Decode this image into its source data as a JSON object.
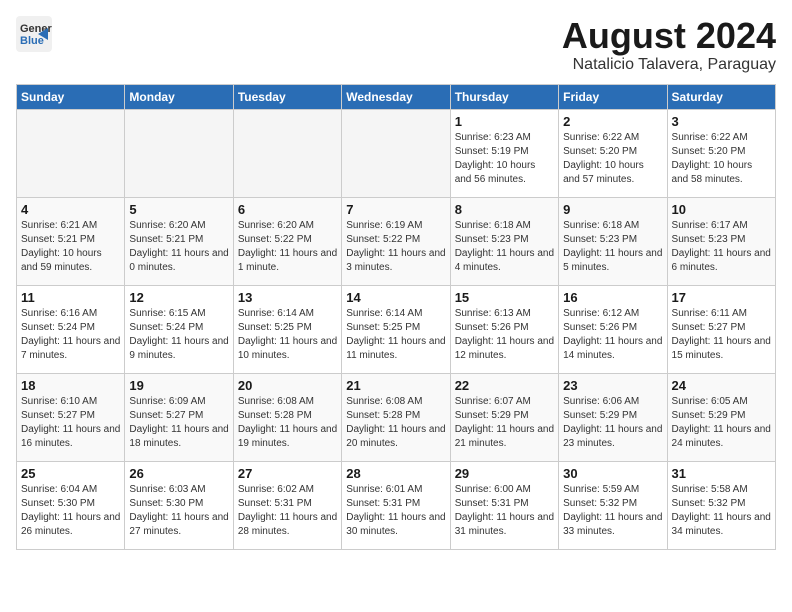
{
  "header": {
    "logo_general": "General",
    "logo_blue": "Blue",
    "month_year": "August 2024",
    "location": "Natalicio Talavera, Paraguay"
  },
  "days_of_week": [
    "Sunday",
    "Monday",
    "Tuesday",
    "Wednesday",
    "Thursday",
    "Friday",
    "Saturday"
  ],
  "weeks": [
    [
      {
        "day": "",
        "sunrise": "",
        "sunset": "",
        "daylight": "",
        "empty": true
      },
      {
        "day": "",
        "sunrise": "",
        "sunset": "",
        "daylight": "",
        "empty": true
      },
      {
        "day": "",
        "sunrise": "",
        "sunset": "",
        "daylight": "",
        "empty": true
      },
      {
        "day": "",
        "sunrise": "",
        "sunset": "",
        "daylight": "",
        "empty": true
      },
      {
        "day": "1",
        "sunrise": "Sunrise: 6:23 AM",
        "sunset": "Sunset: 5:19 PM",
        "daylight": "Daylight: 10 hours and 56 minutes."
      },
      {
        "day": "2",
        "sunrise": "Sunrise: 6:22 AM",
        "sunset": "Sunset: 5:20 PM",
        "daylight": "Daylight: 10 hours and 57 minutes."
      },
      {
        "day": "3",
        "sunrise": "Sunrise: 6:22 AM",
        "sunset": "Sunset: 5:20 PM",
        "daylight": "Daylight: 10 hours and 58 minutes."
      }
    ],
    [
      {
        "day": "4",
        "sunrise": "Sunrise: 6:21 AM",
        "sunset": "Sunset: 5:21 PM",
        "daylight": "Daylight: 10 hours and 59 minutes."
      },
      {
        "day": "5",
        "sunrise": "Sunrise: 6:20 AM",
        "sunset": "Sunset: 5:21 PM",
        "daylight": "Daylight: 11 hours and 0 minutes."
      },
      {
        "day": "6",
        "sunrise": "Sunrise: 6:20 AM",
        "sunset": "Sunset: 5:22 PM",
        "daylight": "Daylight: 11 hours and 1 minute."
      },
      {
        "day": "7",
        "sunrise": "Sunrise: 6:19 AM",
        "sunset": "Sunset: 5:22 PM",
        "daylight": "Daylight: 11 hours and 3 minutes."
      },
      {
        "day": "8",
        "sunrise": "Sunrise: 6:18 AM",
        "sunset": "Sunset: 5:23 PM",
        "daylight": "Daylight: 11 hours and 4 minutes."
      },
      {
        "day": "9",
        "sunrise": "Sunrise: 6:18 AM",
        "sunset": "Sunset: 5:23 PM",
        "daylight": "Daylight: 11 hours and 5 minutes."
      },
      {
        "day": "10",
        "sunrise": "Sunrise: 6:17 AM",
        "sunset": "Sunset: 5:23 PM",
        "daylight": "Daylight: 11 hours and 6 minutes."
      }
    ],
    [
      {
        "day": "11",
        "sunrise": "Sunrise: 6:16 AM",
        "sunset": "Sunset: 5:24 PM",
        "daylight": "Daylight: 11 hours and 7 minutes."
      },
      {
        "day": "12",
        "sunrise": "Sunrise: 6:15 AM",
        "sunset": "Sunset: 5:24 PM",
        "daylight": "Daylight: 11 hours and 9 minutes."
      },
      {
        "day": "13",
        "sunrise": "Sunrise: 6:14 AM",
        "sunset": "Sunset: 5:25 PM",
        "daylight": "Daylight: 11 hours and 10 minutes."
      },
      {
        "day": "14",
        "sunrise": "Sunrise: 6:14 AM",
        "sunset": "Sunset: 5:25 PM",
        "daylight": "Daylight: 11 hours and 11 minutes."
      },
      {
        "day": "15",
        "sunrise": "Sunrise: 6:13 AM",
        "sunset": "Sunset: 5:26 PM",
        "daylight": "Daylight: 11 hours and 12 minutes."
      },
      {
        "day": "16",
        "sunrise": "Sunrise: 6:12 AM",
        "sunset": "Sunset: 5:26 PM",
        "daylight": "Daylight: 11 hours and 14 minutes."
      },
      {
        "day": "17",
        "sunrise": "Sunrise: 6:11 AM",
        "sunset": "Sunset: 5:27 PM",
        "daylight": "Daylight: 11 hours and 15 minutes."
      }
    ],
    [
      {
        "day": "18",
        "sunrise": "Sunrise: 6:10 AM",
        "sunset": "Sunset: 5:27 PM",
        "daylight": "Daylight: 11 hours and 16 minutes."
      },
      {
        "day": "19",
        "sunrise": "Sunrise: 6:09 AM",
        "sunset": "Sunset: 5:27 PM",
        "daylight": "Daylight: 11 hours and 18 minutes."
      },
      {
        "day": "20",
        "sunrise": "Sunrise: 6:08 AM",
        "sunset": "Sunset: 5:28 PM",
        "daylight": "Daylight: 11 hours and 19 minutes."
      },
      {
        "day": "21",
        "sunrise": "Sunrise: 6:08 AM",
        "sunset": "Sunset: 5:28 PM",
        "daylight": "Daylight: 11 hours and 20 minutes."
      },
      {
        "day": "22",
        "sunrise": "Sunrise: 6:07 AM",
        "sunset": "Sunset: 5:29 PM",
        "daylight": "Daylight: 11 hours and 21 minutes."
      },
      {
        "day": "23",
        "sunrise": "Sunrise: 6:06 AM",
        "sunset": "Sunset: 5:29 PM",
        "daylight": "Daylight: 11 hours and 23 minutes."
      },
      {
        "day": "24",
        "sunrise": "Sunrise: 6:05 AM",
        "sunset": "Sunset: 5:29 PM",
        "daylight": "Daylight: 11 hours and 24 minutes."
      }
    ],
    [
      {
        "day": "25",
        "sunrise": "Sunrise: 6:04 AM",
        "sunset": "Sunset: 5:30 PM",
        "daylight": "Daylight: 11 hours and 26 minutes."
      },
      {
        "day": "26",
        "sunrise": "Sunrise: 6:03 AM",
        "sunset": "Sunset: 5:30 PM",
        "daylight": "Daylight: 11 hours and 27 minutes."
      },
      {
        "day": "27",
        "sunrise": "Sunrise: 6:02 AM",
        "sunset": "Sunset: 5:31 PM",
        "daylight": "Daylight: 11 hours and 28 minutes."
      },
      {
        "day": "28",
        "sunrise": "Sunrise: 6:01 AM",
        "sunset": "Sunset: 5:31 PM",
        "daylight": "Daylight: 11 hours and 30 minutes."
      },
      {
        "day": "29",
        "sunrise": "Sunrise: 6:00 AM",
        "sunset": "Sunset: 5:31 PM",
        "daylight": "Daylight: 11 hours and 31 minutes."
      },
      {
        "day": "30",
        "sunrise": "Sunrise: 5:59 AM",
        "sunset": "Sunset: 5:32 PM",
        "daylight": "Daylight: 11 hours and 33 minutes."
      },
      {
        "day": "31",
        "sunrise": "Sunrise: 5:58 AM",
        "sunset": "Sunset: 5:32 PM",
        "daylight": "Daylight: 11 hours and 34 minutes."
      }
    ]
  ]
}
